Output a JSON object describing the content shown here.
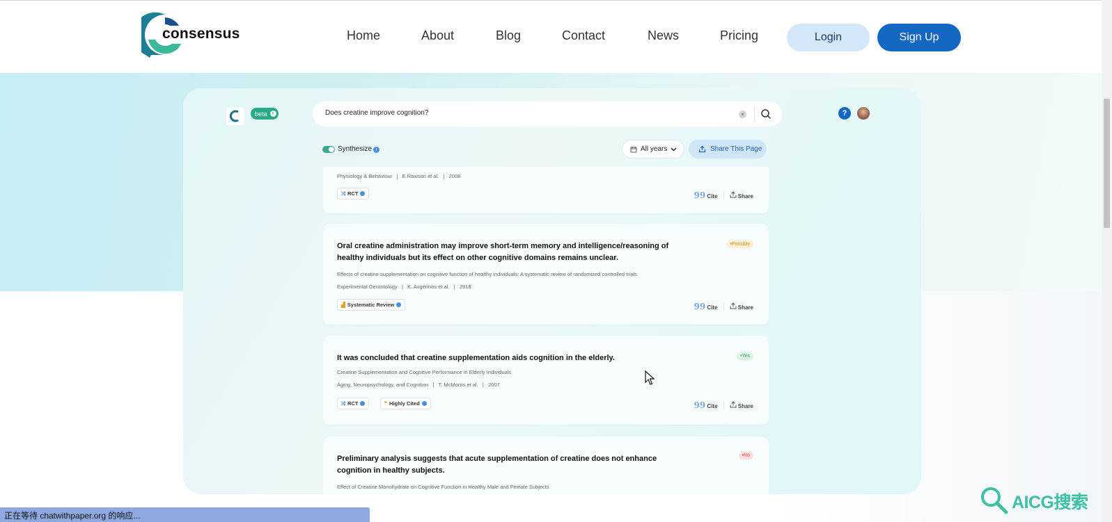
{
  "brand": {
    "name": "consensus"
  },
  "nav": {
    "items": [
      {
        "label": "Home"
      },
      {
        "label": "About"
      },
      {
        "label": "Blog"
      },
      {
        "label": "Contact"
      },
      {
        "label": "News"
      },
      {
        "label": "Pricing"
      }
    ],
    "login_label": "Login",
    "signup_label": "Sign Up"
  },
  "app": {
    "beta_label": "beta",
    "search": {
      "value": "Does creatine improve cognition?"
    },
    "synthesize_label": "Synthesize",
    "synthesize_on": true,
    "years_label": "All years",
    "share_page_label": "Share This Page",
    "cite_label": "Cite",
    "share_label": "Share"
  },
  "results": [
    {
      "meta_journal": "Physiology & Behaviour",
      "meta_authors": "E.Rawson et al.",
      "meta_year": "2008",
      "tags": [
        "RCT"
      ]
    },
    {
      "title": "Oral creatine administration may improve short-term memory and intelligence/reasoning of healthy individuals but its effect on other cognitive domains remains unclear.",
      "subtitle": "Effects of creatine supplementation on cognitive function of healthy individuals: A systematic review of randomized controlled trials",
      "meta_journal": "Experimental Gerontology",
      "meta_authors": "K. Avgerinos et al.",
      "meta_year": "2018",
      "tags": [
        "Systematic Review"
      ],
      "badge": "•Possibly"
    },
    {
      "title": "It was concluded that creatine supplementation aids cognition in the elderly.",
      "subtitle": "Creatine Supplementation and Cognitive Performance in Elderly Individuals",
      "meta_journal": "Aging, Neuropsychology, and Cognition",
      "meta_authors": "T. McMorris et al.",
      "meta_year": "2007",
      "tags": [
        "RCT",
        "Highly Cited"
      ],
      "badge": "•Yes"
    },
    {
      "title": "Preliminary analysis suggests that acute supplementation of creatine does not enhance cognition in healthy subjects.",
      "subtitle": "Effect of Creatine Monohydrate on Cognitive Function in Healthy Male and Female Subjects",
      "badge": "•No"
    }
  ],
  "status_bar": {
    "text": "正在等待 chatwithpaper.org 的响应..."
  },
  "watermark": {
    "text": "AICG搜索"
  },
  "colors": {
    "primary": "#1467c0",
    "login_bg": "#d4e7f9",
    "accent_green": "#2aa987",
    "possibly": "#c78a18",
    "yes": "#3c9b5b",
    "no": "#cc4a4d"
  }
}
